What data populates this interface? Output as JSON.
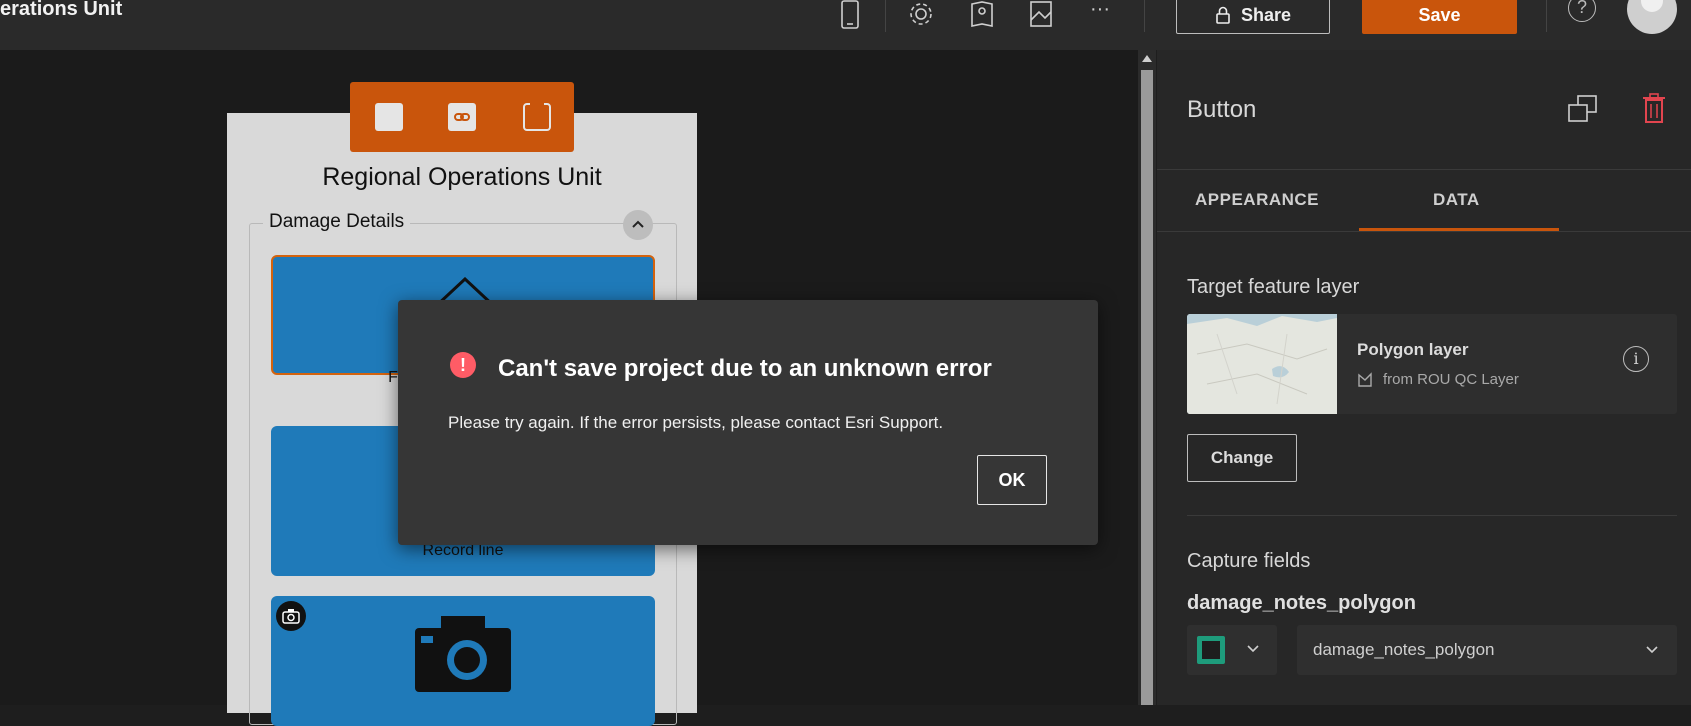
{
  "header": {
    "title": "erations Unit",
    "share_label": "Share",
    "save_label": "Save",
    "help_glyph": "?",
    "more_glyph": "···"
  },
  "canvas": {
    "form_title": "Regional Operations Unit",
    "group_label": "Damage Details",
    "cards": [
      {
        "label": "F"
      },
      {
        "label": "Record line"
      },
      {
        "label": ""
      }
    ]
  },
  "modal": {
    "icon_glyph": "!",
    "title": "Can't save project due to an unknown error",
    "message": "Please try again. If the error persists, please contact Esri Support.",
    "ok_label": "OK"
  },
  "panel": {
    "title": "Button",
    "tabs": [
      "APPEARANCE",
      "DATA"
    ],
    "target_layer_label": "Target feature layer",
    "layer": {
      "name": "Polygon layer",
      "source": "from ROU QC Layer"
    },
    "change_label": "Change",
    "capture_fields_label": "Capture fields",
    "field_name": "damage_notes_polygon",
    "field_select_value": "damage_notes_polygon"
  },
  "colors": {
    "accent": "#c9550c",
    "card": "#1f7ab9",
    "error": "#ff5c66"
  }
}
